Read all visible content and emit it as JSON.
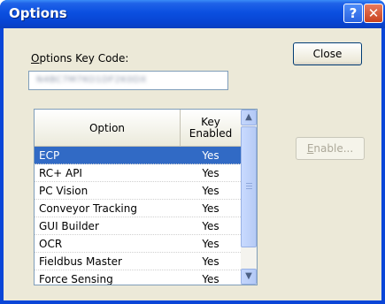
{
  "window": {
    "title": "Options"
  },
  "titlebar_buttons": {
    "help": "?",
    "close": "✕"
  },
  "key_code": {
    "label_accel": "O",
    "label_rest": "ptions Key Code:",
    "value": "N4BC7M7KO1DF2K0DX"
  },
  "buttons": {
    "close": "Close",
    "enable_accel": "E",
    "enable_rest": "nable..."
  },
  "table": {
    "columns": [
      "Option",
      "Key Enabled"
    ],
    "column2_line1": "Key",
    "column2_line2": "Enabled",
    "rows": [
      {
        "option": "ECP",
        "enabled": "Yes",
        "selected": true
      },
      {
        "option": "RC+ API",
        "enabled": "Yes"
      },
      {
        "option": "PC Vision",
        "enabled": "Yes"
      },
      {
        "option": "Conveyor Tracking",
        "enabled": "Yes"
      },
      {
        "option": "GUI Builder",
        "enabled": "Yes"
      },
      {
        "option": "OCR",
        "enabled": "Yes"
      },
      {
        "option": "Fieldbus Master",
        "enabled": "Yes"
      },
      {
        "option": "Force Sensing",
        "enabled": "Yes"
      }
    ]
  },
  "scrollbar": {
    "up": "▲",
    "down": "▼"
  },
  "colors": {
    "selection": "#316ac5",
    "titlebar": "#0b4fe0",
    "face": "#ece9d8"
  }
}
